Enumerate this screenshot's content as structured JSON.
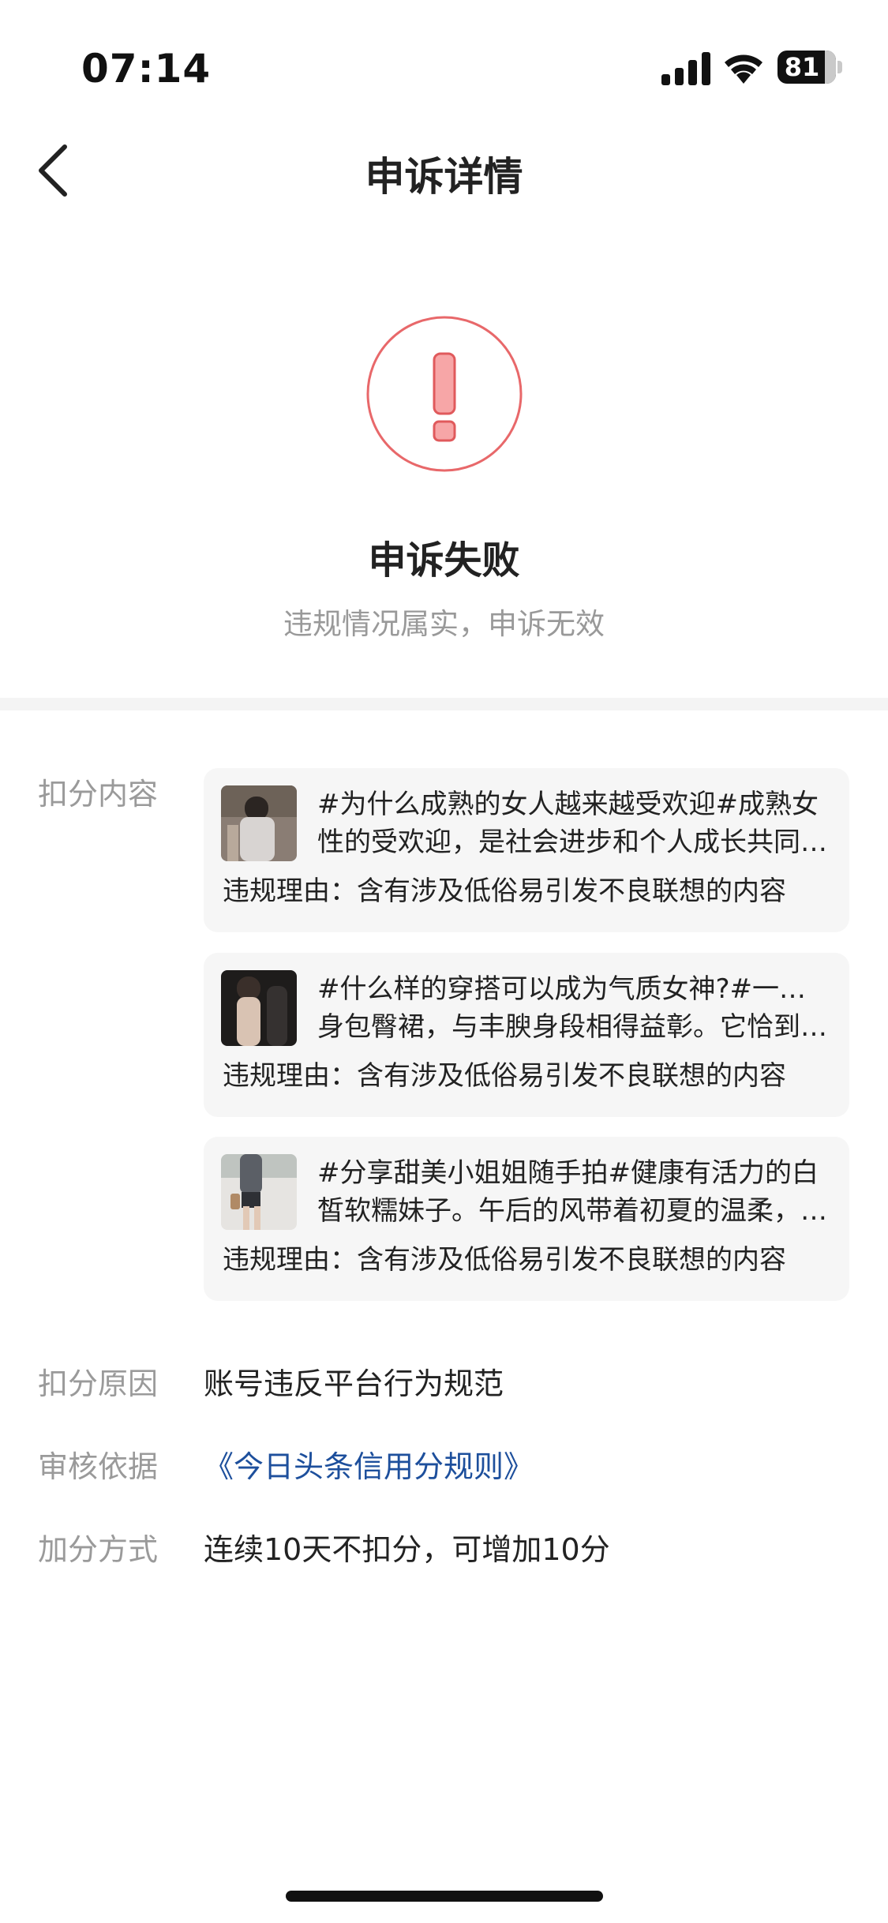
{
  "status_bar": {
    "time": "07:14",
    "battery_level": "81",
    "icons": [
      "signal-icon",
      "wifi-icon",
      "battery-icon"
    ]
  },
  "nav": {
    "back_icon": "chevron-left-icon",
    "title": "申诉详情"
  },
  "result": {
    "icon": "exclamation-circle-icon",
    "title": "申诉失败",
    "subtitle": "违规情况属实，申诉无效"
  },
  "details": {
    "deduction_content_label": "扣分内容",
    "items": [
      {
        "thumbnail": "post-thumbnail",
        "text_line1": "#为什么成熟的女人越来越受欢迎#成熟女",
        "text_line2": "性的受欢迎，是社会进步和个人成长共同…",
        "reason": "违规理由：含有涉及低俗易引发不良联想的内容"
      },
      {
        "thumbnail": "post-thumbnail",
        "text_line1": "#什么样的穿搭可以成为气质女神?#一袭紧",
        "text_line2": "身包臀裙，与丰腴身段相得益彰。它恰到…",
        "reason": "违规理由：含有涉及低俗易引发不良联想的内容"
      },
      {
        "thumbnail": "post-thumbnail",
        "text_line1": "#分享甜美小姐姐随手拍#健康有活力的白",
        "text_line2": "皙软糯妹子。午后的风带着初夏的温柔，…",
        "reason": "违规理由：含有涉及低俗易引发不良联想的内容"
      }
    ],
    "reason_label": "扣分原因",
    "reason_value": "账号违反平台行为规范",
    "basis_label": "审核依据",
    "basis_value": "《今日头条信用分规则》",
    "bonus_label": "加分方式",
    "bonus_value": "连续10天不扣分，可增加10分"
  },
  "colors": {
    "accent_error": "#e8686a",
    "link": "#1d4f9c",
    "label_gray": "#9a9a9a"
  }
}
